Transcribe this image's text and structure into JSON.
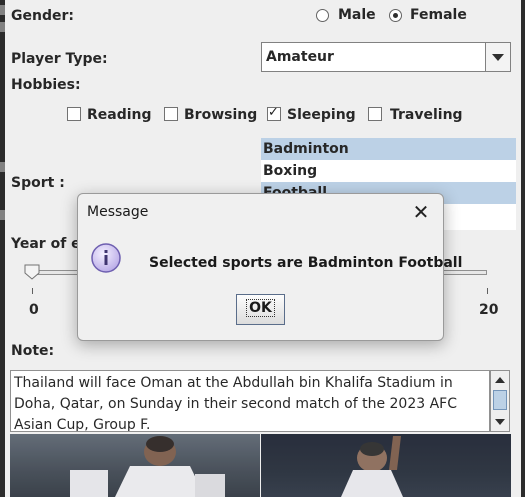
{
  "form": {
    "gender_label": "Gender:",
    "gender_options": [
      {
        "label": "Male",
        "selected": false
      },
      {
        "label": "Female",
        "selected": true
      }
    ],
    "player_type_label": "Player Type:",
    "player_type_value": "Amateur",
    "hobbies_label": "Hobbies:",
    "hobbies": [
      {
        "label": "Reading",
        "checked": false
      },
      {
        "label": "Browsing",
        "checked": false
      },
      {
        "label": "Sleeping",
        "checked": true
      },
      {
        "label": "Traveling",
        "checked": false
      }
    ],
    "sport_label": "Sport :",
    "sports": [
      {
        "label": "Badminton",
        "selected": true
      },
      {
        "label": "Boxing",
        "selected": false
      },
      {
        "label": "Football",
        "selected": true
      }
    ],
    "year_label": "Year of ex",
    "slider_min": "0",
    "slider_max": "20",
    "slider_value": 0,
    "note_label": "Note:",
    "note_text": "Thailand will face Oman at the Abdullah bin Khalifa Stadium in Doha, Qatar, on Sunday in their second match of the 2023 AFC Asian Cup, Group F."
  },
  "dialog": {
    "title": "Message",
    "message": "Selected sports are Badminton Football",
    "ok_label": "OK",
    "icon": "info-icon"
  },
  "colors": {
    "panel_bg": "#eeeeee",
    "selection_bg": "#b8cfe5",
    "dialog_bg": "#f0f0f0"
  }
}
